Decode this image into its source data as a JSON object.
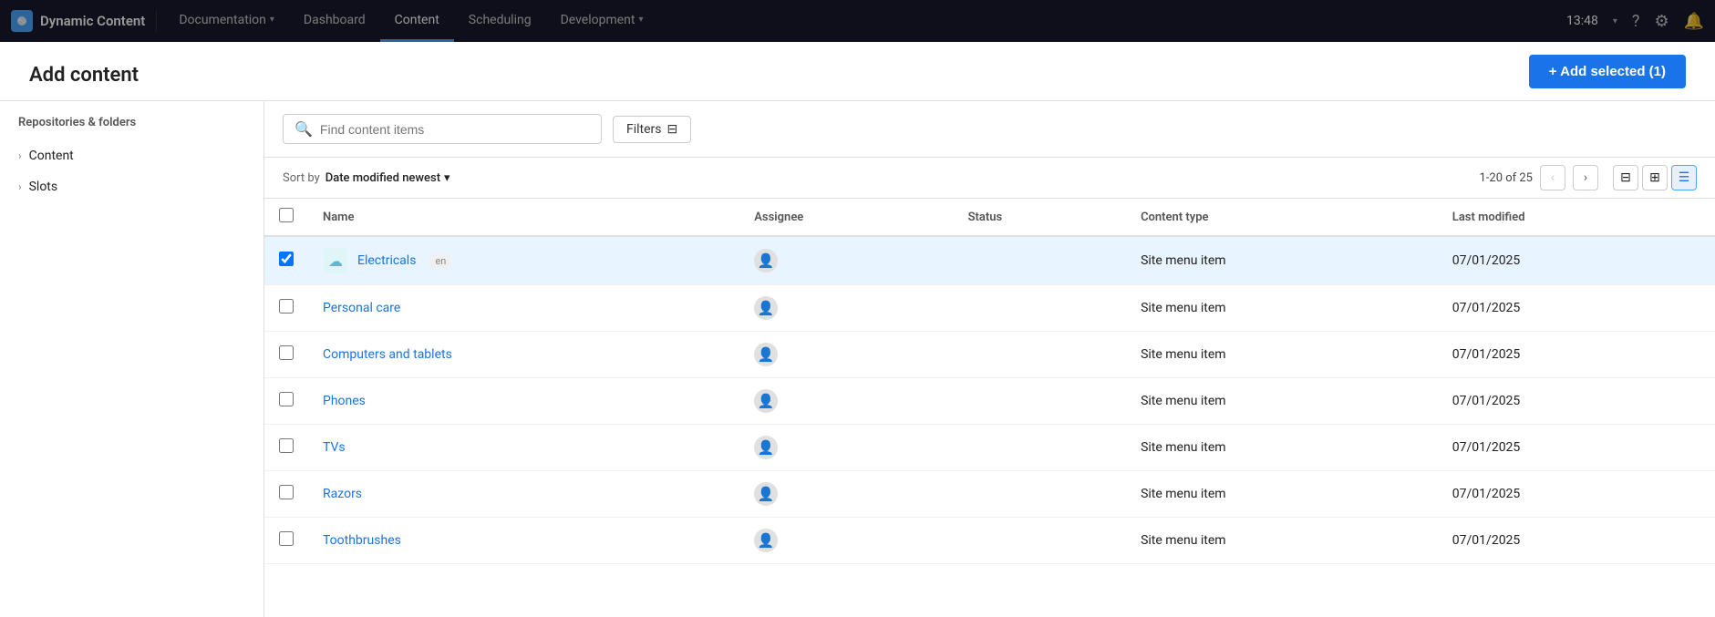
{
  "app": {
    "name": "Dynamic Content",
    "time": "13:48"
  },
  "nav": {
    "items": [
      {
        "label": "Documentation",
        "hasArrow": true,
        "active": false
      },
      {
        "label": "Dashboard",
        "hasArrow": false,
        "active": false
      },
      {
        "label": "Content",
        "hasArrow": false,
        "active": true
      },
      {
        "label": "Scheduling",
        "hasArrow": false,
        "active": false
      },
      {
        "label": "Development",
        "hasArrow": true,
        "active": false
      }
    ]
  },
  "modal": {
    "title": "Add content",
    "close_label": "×"
  },
  "left_panel": {
    "title": "Repositories & folders",
    "items": [
      {
        "label": "Content"
      },
      {
        "label": "Slots"
      }
    ]
  },
  "toolbar": {
    "search_placeholder": "Find content items",
    "filters_label": "Filters",
    "add_selected_label": "+ Add selected (1)"
  },
  "sort": {
    "label": "Sort by",
    "value": "Date modified newest",
    "page_info": "1-20 of 25"
  },
  "table": {
    "columns": [
      "Name",
      "Assignee",
      "Status",
      "Content type",
      "Last modified"
    ],
    "rows": [
      {
        "name": "Electricals",
        "lang": "en",
        "assignee": "",
        "status": "",
        "content_type": "Site menu item",
        "last_modified": "07/01/2025",
        "icon": "cloud",
        "selected": true
      },
      {
        "name": "Personal care",
        "lang": "",
        "assignee": "",
        "status": "",
        "content_type": "Site menu item",
        "last_modified": "07/01/2025",
        "icon": "",
        "selected": false
      },
      {
        "name": "Computers and tablets",
        "lang": "",
        "assignee": "",
        "status": "",
        "content_type": "Site menu item",
        "last_modified": "07/01/2025",
        "icon": "",
        "selected": false
      },
      {
        "name": "Phones",
        "lang": "",
        "assignee": "",
        "status": "",
        "content_type": "Site menu item",
        "last_modified": "07/01/2025",
        "icon": "",
        "selected": false
      },
      {
        "name": "TVs",
        "lang": "",
        "assignee": "",
        "status": "",
        "content_type": "Site menu item",
        "last_modified": "07/01/2025",
        "icon": "",
        "selected": false
      },
      {
        "name": "Razors",
        "lang": "",
        "assignee": "",
        "status": "",
        "content_type": "Site menu item",
        "last_modified": "07/01/2025",
        "icon": "",
        "selected": false
      },
      {
        "name": "Toothbrushes",
        "lang": "",
        "assignee": "",
        "status": "",
        "content_type": "Site menu item",
        "last_modified": "07/01/2025",
        "icon": "",
        "selected": false
      }
    ]
  },
  "icons": {
    "search": "🔍",
    "filter": "⊟",
    "chevron_down": "▾",
    "chevron_right": "›",
    "chevron_left": "‹",
    "grid": "⊞",
    "list": "☰",
    "settings": "⚙",
    "cloud": "☁",
    "person": "👤",
    "close": "✕"
  }
}
